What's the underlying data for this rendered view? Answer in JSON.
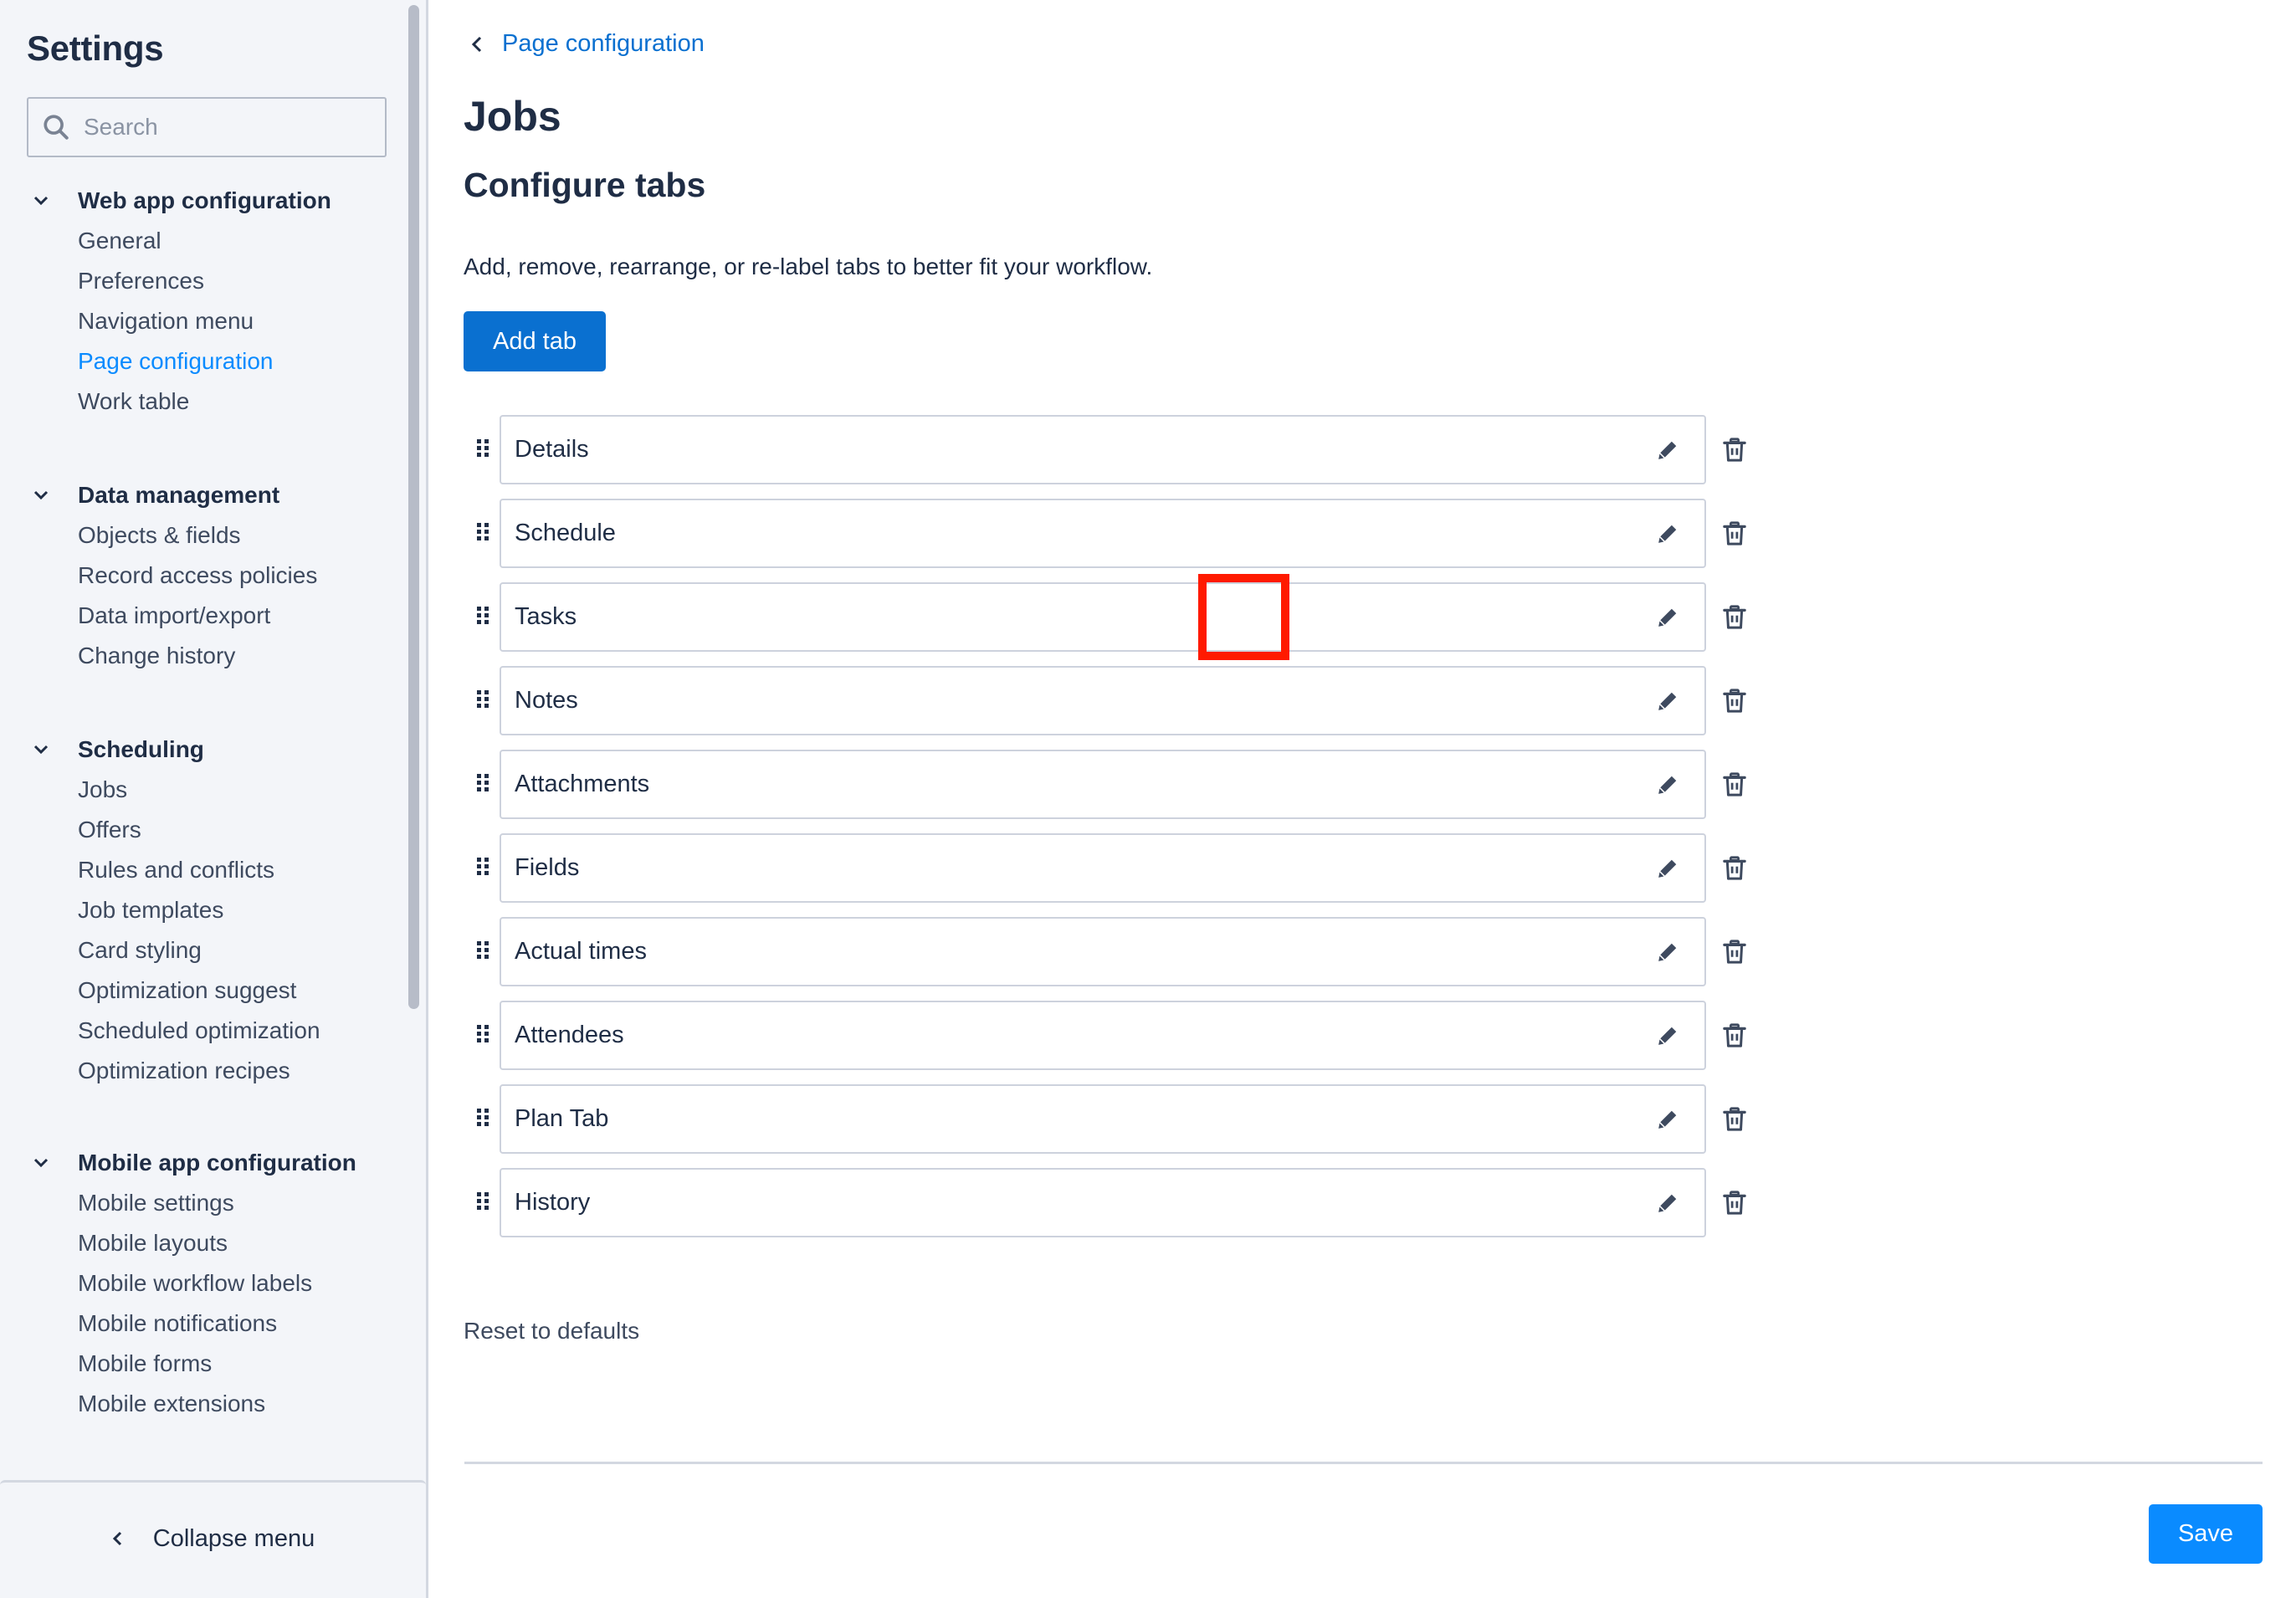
{
  "sidebar": {
    "title": "Settings",
    "search": {
      "placeholder": "Search",
      "value": ""
    },
    "sections": [
      {
        "label": "Web app configuration",
        "expanded": true,
        "items": [
          {
            "label": "General",
            "active": false
          },
          {
            "label": "Preferences",
            "active": false
          },
          {
            "label": "Navigation menu",
            "active": false
          },
          {
            "label": "Page configuration",
            "active": true
          },
          {
            "label": "Work table",
            "active": false
          }
        ]
      },
      {
        "label": "Data management",
        "expanded": true,
        "items": [
          {
            "label": "Objects & fields",
            "active": false
          },
          {
            "label": "Record access policies",
            "active": false
          },
          {
            "label": "Data import/export",
            "active": false
          },
          {
            "label": "Change history",
            "active": false
          }
        ]
      },
      {
        "label": "Scheduling",
        "expanded": true,
        "items": [
          {
            "label": "Jobs",
            "active": false
          },
          {
            "label": "Offers",
            "active": false
          },
          {
            "label": "Rules and conflicts",
            "active": false
          },
          {
            "label": "Job templates",
            "active": false
          },
          {
            "label": "Card styling",
            "active": false
          },
          {
            "label": "Optimization suggest",
            "active": false
          },
          {
            "label": "Scheduled optimization",
            "active": false
          },
          {
            "label": "Optimization recipes",
            "active": false
          }
        ]
      },
      {
        "label": "Mobile app configuration",
        "expanded": true,
        "items": [
          {
            "label": "Mobile settings",
            "active": false
          },
          {
            "label": "Mobile layouts",
            "active": false
          },
          {
            "label": "Mobile workflow labels",
            "active": false
          },
          {
            "label": "Mobile notifications",
            "active": false
          },
          {
            "label": "Mobile forms",
            "active": false
          },
          {
            "label": "Mobile extensions",
            "active": false
          }
        ]
      }
    ],
    "collapse_label": "Collapse menu"
  },
  "main": {
    "breadcrumb": "Page configuration",
    "title": "Jobs",
    "section_title": "Configure tabs",
    "description": "Add, remove, rearrange, or re-label tabs to better fit your workflow.",
    "add_button": "Add tab",
    "tabs": [
      {
        "label": "Details"
      },
      {
        "label": "Schedule"
      },
      {
        "label": "Tasks",
        "highlighted_action": "delete"
      },
      {
        "label": "Notes"
      },
      {
        "label": "Attachments"
      },
      {
        "label": "Fields"
      },
      {
        "label": "Actual times"
      },
      {
        "label": "Attendees"
      },
      {
        "label": "Plan Tab"
      },
      {
        "label": "History"
      }
    ],
    "reset_label": "Reset to defaults",
    "save_button": "Save"
  },
  "icons": {
    "search": "search-icon",
    "section_toggle": "chevron-down-icon",
    "collapse": "chevron-left-icon",
    "back": "chevron-left-icon",
    "drag": "drag-handle-icon",
    "edit": "pencil-icon",
    "delete": "trash-icon"
  },
  "colors": {
    "primary_button": "#0a70d0",
    "save_button": "#0a8bff",
    "active_nav": "#0a8bff",
    "link": "#0a70d0",
    "highlight": "#ff1a00",
    "sidebar_bg": "#f3f5f9",
    "text": "#1f2d45"
  }
}
